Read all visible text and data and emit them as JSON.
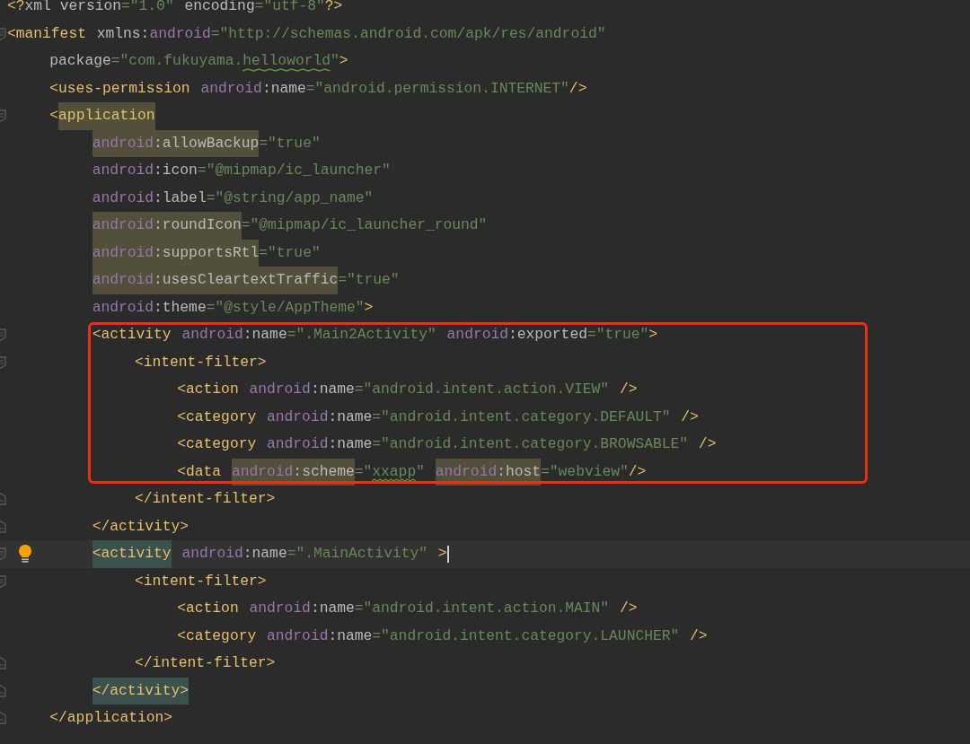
{
  "editor": {
    "blocks": [
      {
        "kind": "code",
        "lines": [
          {
            "tokens": [
              {
                "kind": "tag",
                "text": "<?"
              },
              {
                "kind": "plain",
                "text": "xml version"
              },
              {
                "kind": "value",
                "text": "=\"1.0\""
              },
              {
                "kind": "plain",
                "text": " encoding"
              },
              {
                "kind": "value",
                "text": "=\"utf-8\""
              },
              {
                "kind": "tag",
                "text": "?>"
              }
            ]
          },
          {
            "fold_start": true,
            "tokens": [
              {
                "kind": "tag",
                "text": "<manifest"
              },
              {
                "kind": "plain",
                "text": " xmlns:"
              },
              {
                "kind": "ns",
                "text": "android"
              },
              {
                "kind": "value",
                "text": "=\"http://schemas.android.com/apk/res/android\""
              }
            ]
          },
          {
            "tokens": [
              {
                "kind": "plain",
                "text": "    package"
              },
              {
                "kind": "value",
                "text": "=\"com.fukuyama."
              },
              {
                "kind": "value",
                "text": "helloworld",
                "squiggle": true
              },
              {
                "kind": "value",
                "text": "\""
              },
              {
                "kind": "tag",
                "text": ">"
              }
            ]
          },
          {
            "tokens": [
              {
                "kind": "tag",
                "text": "    <uses-permission"
              },
              {
                "kind": "ns",
                "text": " android"
              },
              {
                "kind": "plain",
                "text": ":name"
              },
              {
                "kind": "value",
                "text": "=\"android.permission.INTERNET\""
              },
              {
                "kind": "tag",
                "text": "/>"
              }
            ]
          },
          {
            "fold_start": true,
            "tokens": [
              {
                "kind": "tag",
                "text": "    <"
              },
              {
                "kind": "tag",
                "text": "application",
                "usage_highlight": true
              }
            ]
          },
          {
            "tokens": [
              {
                "kind": "ns",
                "text": "        android",
                "usage_highlight": true
              },
              {
                "kind": "plain",
                "text": ":allowBackup",
                "usage_highlight": true
              },
              {
                "kind": "value",
                "text": "=\"true\""
              }
            ]
          },
          {
            "tokens": [
              {
                "kind": "ns",
                "text": "        android"
              },
              {
                "kind": "plain",
                "text": ":icon"
              },
              {
                "kind": "value",
                "text": "=\"@mipmap/ic_launcher\""
              }
            ]
          },
          {
            "tokens": [
              {
                "kind": "ns",
                "text": "        android"
              },
              {
                "kind": "plain",
                "text": ":label"
              },
              {
                "kind": "value",
                "text": "=\"@string/app_name\""
              }
            ]
          },
          {
            "tokens": [
              {
                "kind": "ns",
                "text": "        android",
                "usage_highlight": true
              },
              {
                "kind": "plain",
                "text": ":roundIcon",
                "usage_highlight": true
              },
              {
                "kind": "value",
                "text": "=\"@mipmap/ic_launcher_round\""
              }
            ]
          },
          {
            "tokens": [
              {
                "kind": "ns",
                "text": "        android",
                "usage_highlight": true
              },
              {
                "kind": "plain",
                "text": ":supportsRtl",
                "usage_highlight": true
              },
              {
                "kind": "value",
                "text": "=\"true\""
              }
            ]
          },
          {
            "tokens": [
              {
                "kind": "ns",
                "text": "        android",
                "usage_highlight": true
              },
              {
                "kind": "plain",
                "text": ":usesCleartextTraffic",
                "usage_highlight": true
              },
              {
                "kind": "value",
                "text": "=\"true\""
              }
            ]
          },
          {
            "tokens": [
              {
                "kind": "ns",
                "text": "        android"
              },
              {
                "kind": "plain",
                "text": ":theme"
              },
              {
                "kind": "value",
                "text": "=\"@style/AppTheme\""
              },
              {
                "kind": "tag",
                "text": ">"
              }
            ]
          }
        ]
      },
      {
        "kind": "annotated",
        "lines": [
          {
            "fold_start": true,
            "tokens": [
              {
                "kind": "tag",
                "text": "        <activity"
              },
              {
                "kind": "ns",
                "text": " android"
              },
              {
                "kind": "plain",
                "text": ":name"
              },
              {
                "kind": "value",
                "text": "=\".Main2Activity\""
              },
              {
                "kind": "ns",
                "text": " android"
              },
              {
                "kind": "plain",
                "text": ":exported"
              },
              {
                "kind": "value",
                "text": "=\"true\""
              },
              {
                "kind": "tag",
                "text": ">"
              }
            ]
          },
          {
            "fold_start": true,
            "tokens": [
              {
                "kind": "tag",
                "text": "            <intent-filter>"
              }
            ]
          },
          {
            "tokens": [
              {
                "kind": "tag",
                "text": "                <action"
              },
              {
                "kind": "ns",
                "text": " android"
              },
              {
                "kind": "plain",
                "text": ":name"
              },
              {
                "kind": "value",
                "text": "=\"android.intent.action.VIEW\""
              },
              {
                "kind": "tag",
                "text": " />"
              }
            ]
          },
          {
            "tokens": [
              {
                "kind": "tag",
                "text": "                <category"
              },
              {
                "kind": "ns",
                "text": " android"
              },
              {
                "kind": "plain",
                "text": ":name"
              },
              {
                "kind": "value",
                "text": "=\"android.intent.category.DEFAULT\""
              },
              {
                "kind": "tag",
                "text": " />"
              }
            ]
          },
          {
            "tokens": [
              {
                "kind": "tag",
                "text": "                <category"
              },
              {
                "kind": "ns",
                "text": " android"
              },
              {
                "kind": "plain",
                "text": ":name"
              },
              {
                "kind": "value",
                "text": "=\"android.intent.category.BROWSABLE\""
              },
              {
                "kind": "tag",
                "text": " />"
              }
            ]
          },
          {
            "tokens": [
              {
                "kind": "tag",
                "text": "                <data"
              },
              {
                "kind": "ns",
                "text": " android",
                "usage_highlight": true
              },
              {
                "kind": "plain",
                "text": ":scheme",
                "usage_highlight": true
              },
              {
                "kind": "value",
                "text": "=\""
              },
              {
                "kind": "value",
                "text": "xxapp",
                "squiggle": true
              },
              {
                "kind": "value",
                "text": "\""
              },
              {
                "kind": "ns",
                "text": " android",
                "usage_highlight": true
              },
              {
                "kind": "plain",
                "text": ":host",
                "usage_highlight": true
              },
              {
                "kind": "value",
                "text": "=\"webview\""
              },
              {
                "kind": "tag",
                "text": "/>"
              }
            ]
          }
        ]
      },
      {
        "kind": "code",
        "lines": [
          {
            "fold_end": true,
            "tokens": [
              {
                "kind": "tag",
                "text": "            </intent-filter>"
              }
            ]
          },
          {
            "fold_end": true,
            "tokens": [
              {
                "kind": "tag",
                "text": "        </activity>"
              }
            ]
          },
          {
            "current": true,
            "fold_start": true,
            "bulb": true,
            "cursor": true,
            "tokens": [
              {
                "kind": "tag",
                "text": "        <activity",
                "match_highlight": true
              },
              {
                "kind": "ns",
                "text": " android"
              },
              {
                "kind": "plain",
                "text": ":name"
              },
              {
                "kind": "value",
                "text": "=\".MainActivity\""
              },
              {
                "kind": "tag",
                "text": " >"
              }
            ]
          },
          {
            "fold_start": true,
            "tokens": [
              {
                "kind": "tag",
                "text": "            <intent-filter>"
              }
            ]
          },
          {
            "tokens": [
              {
                "kind": "tag",
                "text": "                <action"
              },
              {
                "kind": "ns",
                "text": " android"
              },
              {
                "kind": "plain",
                "text": ":name"
              },
              {
                "kind": "value",
                "text": "=\"android.intent.action.MAIN\""
              },
              {
                "kind": "tag",
                "text": " />"
              }
            ]
          },
          {
            "tokens": [
              {
                "kind": "tag",
                "text": "                <category"
              },
              {
                "kind": "ns",
                "text": " android"
              },
              {
                "kind": "plain",
                "text": ":name"
              },
              {
                "kind": "value",
                "text": "=\"android.intent.category.LAUNCHER\""
              },
              {
                "kind": "tag",
                "text": " />"
              }
            ]
          },
          {
            "fold_end": true,
            "tokens": [
              {
                "kind": "tag",
                "text": "            </intent-filter>"
              }
            ]
          },
          {
            "fold_end": true,
            "tokens": [
              {
                "kind": "tag",
                "text": "        </activity>",
                "match_highlight": true
              }
            ]
          },
          {
            "fold_end": true,
            "tokens": [
              {
                "kind": "tag",
                "text": "    </application>"
              }
            ]
          }
        ]
      }
    ]
  }
}
